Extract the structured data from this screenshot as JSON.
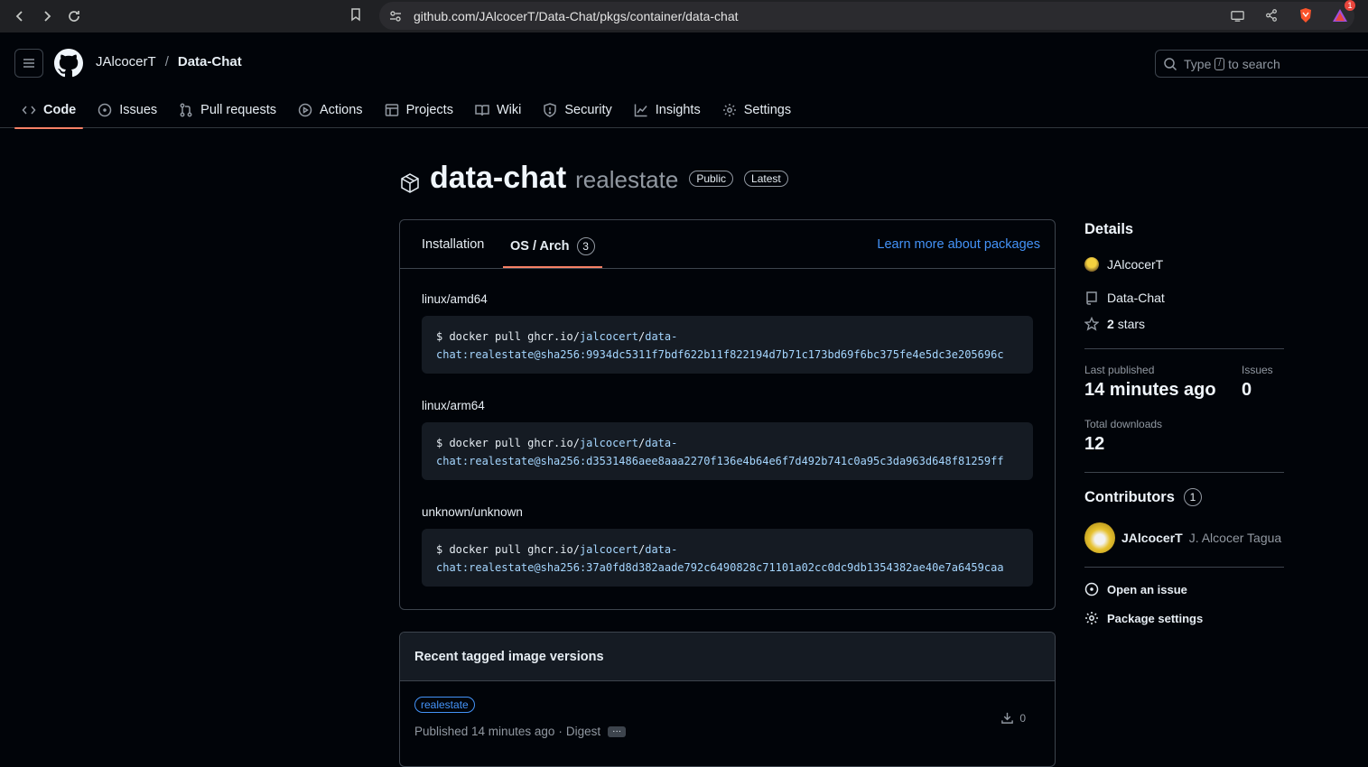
{
  "browser": {
    "url": "github.com/JAlcocerT/Data-Chat/pkgs/container/data-chat",
    "notification_count": "1"
  },
  "header": {
    "owner": "JAlcocerT",
    "separator": "/",
    "repo": "Data-Chat",
    "search_prefix": "Type",
    "search_key": "/",
    "search_suffix": "to search",
    "tabs": [
      {
        "label": "Code",
        "icon": "code-icon",
        "active": true
      },
      {
        "label": "Issues",
        "icon": "issue-icon"
      },
      {
        "label": "Pull requests",
        "icon": "pull-request-icon"
      },
      {
        "label": "Actions",
        "icon": "play-icon"
      },
      {
        "label": "Projects",
        "icon": "table-icon"
      },
      {
        "label": "Wiki",
        "icon": "book-icon"
      },
      {
        "label": "Security",
        "icon": "shield-icon"
      },
      {
        "label": "Insights",
        "icon": "graph-icon"
      },
      {
        "label": "Settings",
        "icon": "gear-icon"
      }
    ]
  },
  "package": {
    "name": "data-chat",
    "tag": "realestate",
    "badges": [
      "Public",
      "Latest"
    ]
  },
  "install_box": {
    "tab_installation": "Installation",
    "tab_os_arch": "OS / Arch",
    "os_arch_count": "3",
    "learn_more": "Learn more about packages",
    "archs": [
      {
        "label": "linux/amd64",
        "cmd_prefix": "$ docker pull ghcr.io/",
        "cmd_owner": "jalcocert",
        "cmd_slash": "/",
        "cmd_repo_start": "data-",
        "cmd_line2": "chat:realestate@sha256:9934dc5311f7bdf622b11f822194d7b71c173bd69f6bc375fe4e5dc3e205696c"
      },
      {
        "label": "linux/arm64",
        "cmd_prefix": "$ docker pull ghcr.io/",
        "cmd_owner": "jalcocert",
        "cmd_slash": "/",
        "cmd_repo_start": "data-",
        "cmd_line2": "chat:realestate@sha256:d3531486aee8aaa2270f136e4b64e6f7d492b741c0a95c3da963d648f81259ff"
      },
      {
        "label": "unknown/unknown",
        "cmd_prefix": "$ docker pull ghcr.io/",
        "cmd_owner": "jalcocert",
        "cmd_slash": "/",
        "cmd_repo_start": "data-",
        "cmd_line2": "chat:realestate@sha256:37a0fd8d382aade792c6490828c71101a02cc0dc9db1354382ae40e7a6459caa"
      }
    ]
  },
  "versions": {
    "heading": "Recent tagged image versions",
    "items": [
      {
        "tag": "realestate",
        "published": "Published 14 minutes ago",
        "sep": "·",
        "digest": "Digest",
        "more": "···",
        "downloads": "0"
      }
    ]
  },
  "sidebar": {
    "details_heading": "Details",
    "owner": "JAlcocerT",
    "repo": "Data-Chat",
    "stars_count": "2",
    "stars_label": "stars",
    "last_published_label": "Last published",
    "last_published_value": "14 minutes ago",
    "issues_label": "Issues",
    "issues_value": "0",
    "total_downloads_label": "Total downloads",
    "total_downloads_value": "12",
    "contributors_heading": "Contributors",
    "contributors_count": "1",
    "contributor_login": "JAlcocerT",
    "contributor_name": "J. Alcocer Tagua",
    "open_issue": "Open an issue",
    "package_settings": "Package settings"
  }
}
